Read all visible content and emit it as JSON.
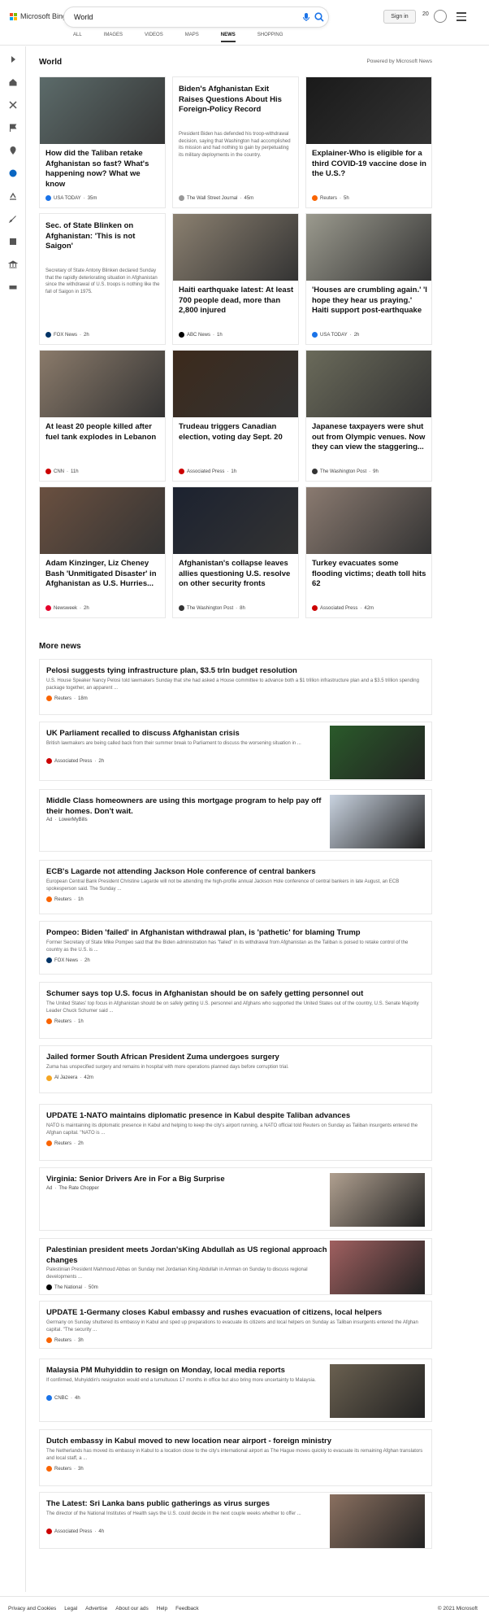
{
  "header": {
    "brand": "Microsoft Bing",
    "search_value": "World",
    "sign_in": "Sign in",
    "rewards_count": "20",
    "icons": [
      "search-icon",
      "mic-icon",
      "medal-icon",
      "hamburger-icon"
    ]
  },
  "tabs": [
    "ALL",
    "IMAGES",
    "VIDEOS",
    "MAPS",
    "NEWS",
    "SHOPPING"
  ],
  "active_tab": "NEWS",
  "page": {
    "title": "World",
    "powered": "Powered by Microsoft News"
  },
  "cards": [
    {
      "title": "How did the Taliban retake Afghanistan so fast? What's happening now? What we know",
      "source": "USA TODAY",
      "time": "35m",
      "color": "#1a73e8",
      "img": "#5c6b6a"
    },
    {
      "title": "Biden's Afghanistan Exit Raises Questions About His Foreign-Policy Record",
      "snippet": "President Biden has defended his troop-withdrawal decision, saying that Washington had accomplished its mission and had nothing to gain by perpetuating its military deployments in the country.",
      "source": "The Wall Street Journal",
      "time": "45m",
      "color": "#999",
      "img": ""
    },
    {
      "title": "Explainer-Who is eligible for a third COVID-19 vaccine dose in the U.S.?",
      "source": "Reuters",
      "time": "5h",
      "color": "#fa6400",
      "img": "#1a1a1a"
    },
    {
      "title": "Sec. of State Blinken on Afghanistan: 'This is not Saigon'",
      "snippet": "Secretary of State Antony Blinken declared Sunday that the rapidly deteriorating situation in Afghanistan since the withdrawal of U.S. troops is nothing like the fall of Saigon in 1975.",
      "source": "FOX News",
      "time": "2h",
      "color": "#003366",
      "img": ""
    },
    {
      "title": "Haiti earthquake latest: At least 700 people dead, more than 2,800 injured",
      "source": "ABC News",
      "time": "1h",
      "color": "#000",
      "img": "#8b8070"
    },
    {
      "title": "'Houses are crumbling again.' 'I hope they hear us praying.' Haiti support post-earthquake",
      "source": "USA TODAY",
      "time": "2h",
      "color": "#1a73e8",
      "img": "#9b9a8e"
    },
    {
      "title": "At least 20 people killed after fuel tank explodes in Lebanon",
      "source": "CNN",
      "time": "11h",
      "color": "#cc0000",
      "img": "#8a7a6a"
    },
    {
      "title": "Trudeau triggers Canadian election, voting day Sept. 20",
      "source": "Associated Press",
      "time": "1h",
      "color": "#cc0000",
      "img": "#3c2a1c"
    },
    {
      "title": "Japanese taxpayers were shut out from Olympic venues. Now they can view the staggering...",
      "source": "The Washington Post",
      "time": "9h",
      "color": "#333",
      "img": "#6a6a5a"
    },
    {
      "title": "Adam Kinzinger, Liz Cheney Bash 'Unmitigated Disaster' in Afghanistan as U.S. Hurries...",
      "source": "Newsweek",
      "time": "2h",
      "color": "#e4002b",
      "img": "#6a5040"
    },
    {
      "title": "Afghanistan's collapse leaves allies questioning U.S. resolve on other security fronts",
      "source": "The Washington Post",
      "time": "8h",
      "color": "#333",
      "img": "#1c2230"
    },
    {
      "title": "Turkey evacuates some flooding victims; death toll hits 62",
      "source": "Associated Press",
      "time": "42m",
      "color": "#cc0000",
      "img": "#8a7a70"
    }
  ],
  "more_news_heading": "More news",
  "more_news": [
    {
      "title": "Pelosi suggests tying infrastructure plan, $3.5 trln budget resolution",
      "snippet": "U.S. House Speaker Nancy Pelosi told lawmakers Sunday that she had asked a House committee to advance both a $1 trillion infrastructure plan and a $3.5 trillion spending package together, an apparent ...",
      "source": "Reuters",
      "time": "18m",
      "color": "#fa6400"
    },
    {
      "title": "UK Parliament recalled to discuss Afghanistan crisis",
      "snippet": "British lawmakers are being called back from their summer break to Parliament to discuss the worsening situation in ...",
      "source": "Associated Press",
      "time": "2h",
      "color": "#cc0000",
      "img": "#2a5a2a"
    },
    {
      "title": "Middle Class homeowners are using this mortgage program to help pay off their homes. Don't wait.",
      "ad": "Ad",
      "source": "LowerMyBills",
      "img": "#c9d3e0"
    },
    {
      "title": "ECB's Lagarde not attending Jackson Hole conference of central bankers",
      "snippet": "European Central Bank President Christine Lagarde will not be attending the high-profile annual Jackson Hole conference of central bankers in late August, an ECB spokesperson said. The Sunday ...",
      "source": "Reuters",
      "time": "1h",
      "color": "#fa6400"
    },
    {
      "title": "Pompeo: Biden 'failed' in Afghanistan withdrawal plan, is 'pathetic' for blaming Trump",
      "snippet": "Former Secretary of State Mike Pompeo said that the Biden administration has \"failed\" in its withdrawal from Afghanistan as the Taliban is poised to retake control of the country as the U.S. is ...",
      "source": "FOX News",
      "time": "2h",
      "color": "#003366"
    },
    {
      "title": "Schumer says top U.S. focus in Afghanistan should be on safely getting personnel out",
      "snippet": "The United States' top focus in Afghanistan should be on safely getting U.S. personnel and Afghans who supported the United States out of the country, U.S. Senate Majority Leader Chuck Schumer said ...",
      "source": "Reuters",
      "time": "1h",
      "color": "#fa6400"
    },
    {
      "title": "Jailed former South African President Zuma undergoes surgery",
      "snippet": "Zuma has unspecified surgery and remains in hospital with more operations planned days before corruption trial.",
      "source": "Al Jazeera",
      "time": "42m",
      "color": "#f5a623"
    },
    {
      "title": "UPDATE 1-NATO maintains diplomatic presence in Kabul despite Taliban advances",
      "snippet": "NATO is maintaining its diplomatic presence in Kabul and helping to keep the city's airport running, a NATO official told Reuters on Sunday as Taliban insurgents entered the Afghan capital. \"NATO is ...",
      "source": "Reuters",
      "time": "2h",
      "color": "#fa6400"
    },
    {
      "title": "Virginia: Senior Drivers Are in For a Big Surprise",
      "ad": "Ad",
      "source": "The Rate Chopper",
      "img": "#b0a090"
    },
    {
      "title": "Palestinian president meets Jordan'sKing Abdullah as US regional approach changes",
      "snippet": "Palestinian President Mahmoud Abbas on Sunday met Jordanian King Abdullah in Amman on Sunday to discuss regional developments ...",
      "source": "The National",
      "time": "50m",
      "color": "#000",
      "img": "#a06060"
    },
    {
      "title": "UPDATE 1-Germany closes Kabul embassy and rushes evacuation of citizens, local helpers",
      "snippet": "Germany on Sunday shuttered its embassy in Kabul and sped up preparations to evacuate its citizens and local helpers on Sunday as Taliban insurgents entered the Afghan capital. \"The security ...",
      "source": "Reuters",
      "time": "3h",
      "color": "#fa6400"
    },
    {
      "title": "Malaysia PM Muhyiddin to resign on Monday, local media reports",
      "snippet": "If confirmed, Muhyiddin's resignation would end a tumultuous 17 months in office but also bring more uncertainty to Malaysia.",
      "source": "CNBC",
      "time": "4h",
      "color": "#1a73e8",
      "img": "#6a6050"
    },
    {
      "title": "Dutch embassy in Kabul moved to new location near airport - foreign ministry",
      "snippet": "The Netherlands has moved its embassy in Kabul to a location close to the city's international airport as The Hague moves quickly to evacuate its remaining Afghan translators and local staff, a ...",
      "source": "Reuters",
      "time": "3h",
      "color": "#fa6400"
    },
    {
      "title": "The Latest: Sri Lanka bans public gatherings as virus surges",
      "snippet": "The director of the National Institutes of Health says the U.S. could decide in the next couple weeks whether to offer ...",
      "source": "Associated Press",
      "time": "4h",
      "color": "#cc0000",
      "img": "#8a7060"
    }
  ],
  "footer": {
    "links": [
      "Privacy and Cookies",
      "Legal",
      "Advertise",
      "About our ads",
      "Help",
      "Feedback"
    ],
    "copyright": "© 2021 Microsoft"
  }
}
